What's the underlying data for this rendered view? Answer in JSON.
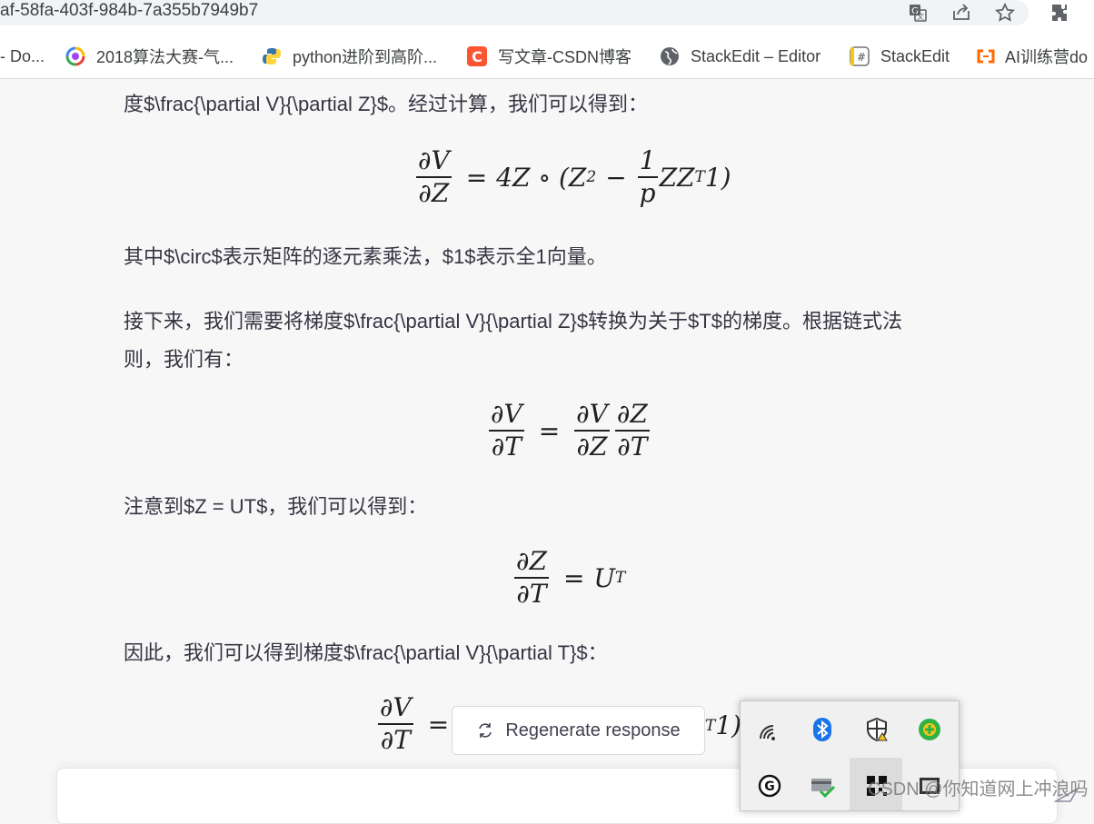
{
  "browser": {
    "url": "af-58fa-403f-984b-7a355b7949b7",
    "icons": [
      "translate-icon",
      "share-icon",
      "star-icon",
      "extensions-icon"
    ],
    "bookmarks": [
      {
        "label": "- Do...",
        "icon": "none"
      },
      {
        "label": "2018算法大赛-气...",
        "icon": "colorful-swirl-icon"
      },
      {
        "label": "python进阶到高阶...",
        "icon": "python-icon"
      },
      {
        "label": "写文章-CSDN博客",
        "icon": "csdn-icon"
      },
      {
        "label": "StackEdit – Editor",
        "icon": "globe-icon"
      },
      {
        "label": "StackEdit",
        "icon": "stackedit-icon"
      },
      {
        "label": "AI训练营do",
        "icon": "aliyun-icon"
      }
    ]
  },
  "chat": {
    "p1": "度$\\frac{\\partial V}{\\partial Z}$。经过计算，我们可以得到：",
    "eq1": {
      "lhs_num": "∂V",
      "lhs_den": "∂Z",
      "rhs_a": "4Z ∘ (Z",
      "sup2": "2",
      "minus": "−",
      "f_num": "1",
      "f_den": "p",
      "rhs_b": "ZZ",
      "supT": "T",
      "rhs_c": "1)"
    },
    "p2": "其中$\\circ$表示矩阵的逐元素乘法，$1$表示全1向量。",
    "p3a": "接下来，我们需要将梯度$\\frac{\\partial V}{\\partial Z}$转换为关于$T$的梯度。根据链式法",
    "p3b": "则，我们有：",
    "eq2": {
      "a_num": "∂V",
      "a_den": "∂T",
      "b_num": "∂V",
      "b_den": "∂Z",
      "c_num": "∂Z",
      "c_den": "∂T"
    },
    "p4": "注意到$Z = UT$，我们可以得到：",
    "eq3": {
      "num": "∂Z",
      "den": "∂T",
      "rhs": "U",
      "sup": "T"
    },
    "p5": "因此，我们可以得到梯度$\\frac{\\partial V}{\\partial T}$：",
    "eq4": {
      "num": "∂V",
      "den": "∂T",
      "tail": "1)",
      "tail_sup": "T"
    },
    "regenerate_label": "Regenerate response"
  },
  "tray": {
    "icons": [
      "wifi-icon",
      "bluetooth-icon",
      "security-shield-icon",
      "green-plus-icon",
      "grammarly-icon",
      "card-check-icon",
      "qr-app-icon",
      "app-icon"
    ]
  },
  "watermark": "CSDN @你知道网上冲浪吗"
}
